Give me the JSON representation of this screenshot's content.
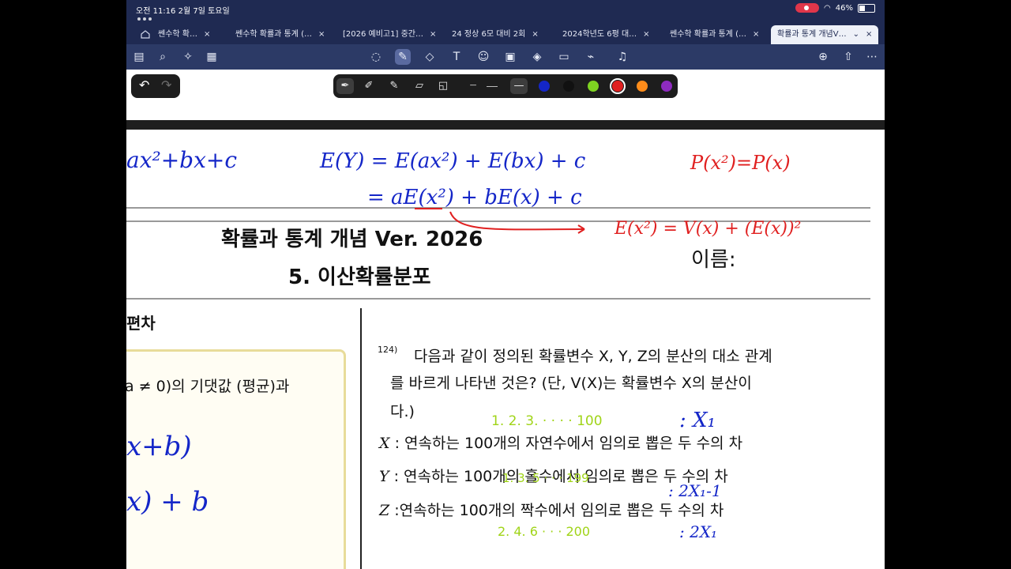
{
  "status": {
    "time": "오전 11:16",
    "date": "2월 7일 토요일",
    "battery": "46%",
    "battery_level": 0.46
  },
  "tabs": [
    {
      "label": "쎈수학 확…"
    },
    {
      "label": "쎈수학 확률과 통계 (…"
    },
    {
      "label": "[2026 예비고1] 중간…"
    },
    {
      "label": "24 정상 6모 대비 2회"
    },
    {
      "label": "2024학년도 6평 대…"
    },
    {
      "label": "쎈수학 확률과 통계 (…"
    },
    {
      "label": "확률과 통계 개념V…",
      "active": true
    }
  ],
  "toolbar": {
    "icons": [
      "sidebar-icon",
      "search-icon",
      "ai-sparkle-icon",
      "document-icon",
      "lasso-icon",
      "pen-icon",
      "eraser-icon",
      "text-box-icon",
      "sticker-icon",
      "image-icon",
      "shapes-icon",
      "note-icon",
      "link-icon",
      "microphone-icon",
      "add-page-icon",
      "share-icon",
      "more-icon"
    ]
  },
  "doc": {
    "title": "확률과 통계 개념 Ver. 2026",
    "section": "5. 이산확률분포",
    "name_label": "이름:",
    "left_heading": "편차",
    "left_box_text": "a ≠ 0)의 기댓값 (평균)과",
    "question": {
      "number": "124)",
      "line1": "다음과 같이 정의된 확률변수 X, Y, Z의 분산의 대소 관계",
      "line2": "를 바르게 나타낸 것은? (단, V(X)는 확률변수 X의 분산이",
      "line3": "다.)",
      "item_x_var": "X",
      "item_x": ": 연속하는 100개의 자연수에서 임의로 뽑은 두 수의 차",
      "item_y_var": "Y",
      "item_y": ": 연속하는 100개의 홀수에서 임의로 뽑은 두 수의 차",
      "item_z_var": "Z",
      "item_z": ":연속하는 100개의 짝수에서 임의로 뽑은 두 수의 차"
    },
    "handwriting": {
      "blue_1": "ax²+bx+c",
      "blue_2": "E(Y) = E(ax²) + E(bx) + c",
      "blue_3": "= aE(x²) + bE(x) + c",
      "red_1": "P(x²)=P(x)",
      "red_2": "E(x²) = V(x) + (E(x))²",
      "green_1": "1. 2. 3. · · · · 100",
      "blue_4": ": X₁",
      "green_2": "1. 3. 5 · · · 199",
      "blue_5": ": 2X₁-1",
      "green_3": "2. 4. 6 · · · 200",
      "blue_6": ": 2X₁",
      "blue_7": "x+b)",
      "blue_8": "x) + b"
    }
  },
  "pen_palette": {
    "colors": [
      "#1426c8",
      "#111111",
      "#7ed321",
      "#e02020",
      "#ff8c1a",
      "#8e2bbf"
    ],
    "selected_color": "#e02020"
  }
}
